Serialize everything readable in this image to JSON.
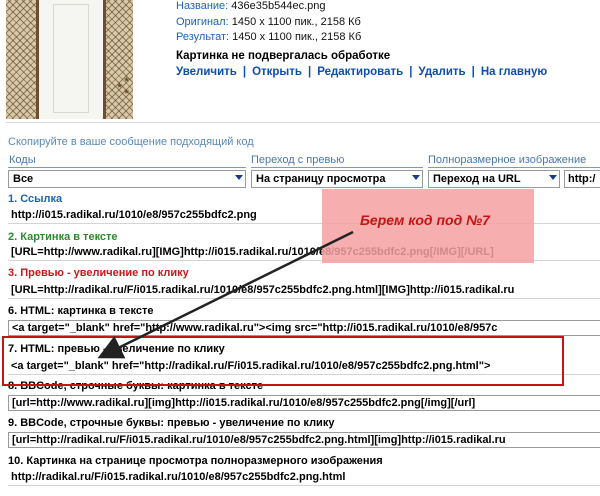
{
  "info": {
    "name_label": "Название:",
    "name_value": "436e35b544ec.png",
    "original_label": "Оригинал:",
    "original_value": "1450 x 1100 пик., 2158 Кб",
    "result_label": "Результат:",
    "result_value": "1450 x 1100 пик., 2158 Кб",
    "status": "Картинка не подвергалась обработке"
  },
  "links": [
    {
      "label": "Увеличить"
    },
    {
      "label": "Открыть"
    },
    {
      "label": "Редактировать"
    },
    {
      "label": "Удалить"
    },
    {
      "label": "На главную"
    }
  ],
  "copy_hint": "Скопируйте в ваше сообщение подходящий код",
  "selectors": {
    "codes": {
      "header": "Коды",
      "value": "Все"
    },
    "preview": {
      "header": "Переход с превью",
      "value": "На страницу просмотра"
    },
    "fullsize": {
      "header": "Полноразмерное изображение",
      "value": "Переход на URL"
    },
    "url_prefix": "http:/"
  },
  "items": [
    {
      "title": "1. Ссылка",
      "color": "#1c62b6",
      "code": "http://i015.radikal.ru/1010/e8/957c255bdfc2.png"
    },
    {
      "title": "2. Картинка в тексте",
      "color": "#2e8a2e",
      "code": "[URL=http://www.radikal.ru][IMG]http://i015.radikal.ru/1010/e8/957c255bdfc2.png[/IMG][/URL]"
    },
    {
      "title": "3. Превью - увеличение по клику",
      "color": "#c41a1a",
      "code": "[URL=http://radikal.ru/F/i015.radikal.ru/1010/e8/957c255bdfc2.png.html][IMG]http://i015.radikal.ru"
    },
    {
      "title": "6. HTML: картинка в тексте",
      "color": "#000000",
      "code": "<a target=\"_blank\" href=\"http://www.radikal.ru\"><img src=\"http://i015.radikal.ru/1010/e8/957c"
    },
    {
      "title": "7. HTML: превью - увеличение по клику",
      "color": "#000000",
      "code": "<a target=\"_blank\" href=\"http://radikal.ru/F/i015.radikal.ru/1010/e8/957c255bdfc2.png.html\">"
    },
    {
      "title": "8. BBCode, строчные буквы: картинка в тексте",
      "color": "#000000",
      "code": "[url=http://www.radikal.ru][img]http://i015.radikal.ru/1010/e8/957c255bdfc2.png[/img][/url]"
    },
    {
      "title": "9. BBCode, строчные буквы: превью - увеличение по клику",
      "color": "#000000",
      "code": "[url=http://radikal.ru/F/i015.radikal.ru/1010/e8/957c255bdfc2.png.html][img]http://i015.radikal.ru"
    },
    {
      "title": "10. Картинка на странице просмотра полноразмерного изображения",
      "color": "#000000",
      "code": "http://radikal.ru/F/i015.radikal.ru/1010/e8/957c255bdfc2.png.html"
    }
  ],
  "annotation": {
    "text": "Берем код под №7",
    "color": "#c61414",
    "box_color": "#c01818"
  }
}
